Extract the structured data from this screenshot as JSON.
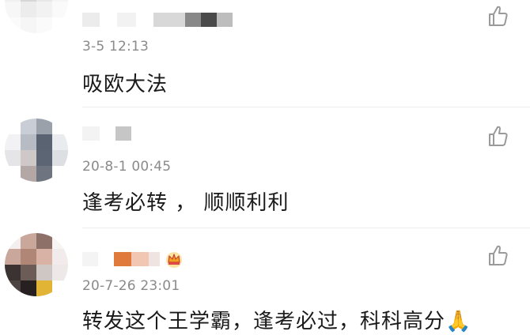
{
  "comments": [
    {
      "timestamp": "3-5 12:13",
      "text": "吸欧大法",
      "like_icon": "thumbs-up-outline-icon"
    },
    {
      "timestamp": "20-8-1 00:45",
      "text": "逢考必转 ， 顺顺利利",
      "like_icon": "thumbs-up-outline-icon"
    },
    {
      "timestamp": "20-7-26 23:01",
      "text": "转发这个王学霸，逢考必过，科科高分",
      "emoji": "🙏",
      "badge_icon": "crown-badge-icon",
      "like_icon": "thumbs-up-outline-icon"
    }
  ],
  "colors": {
    "timestamp": "#8a8a8a",
    "divider": "#eeeeee",
    "like_icon": "#9a9a9a",
    "crown": "#f0a020"
  }
}
